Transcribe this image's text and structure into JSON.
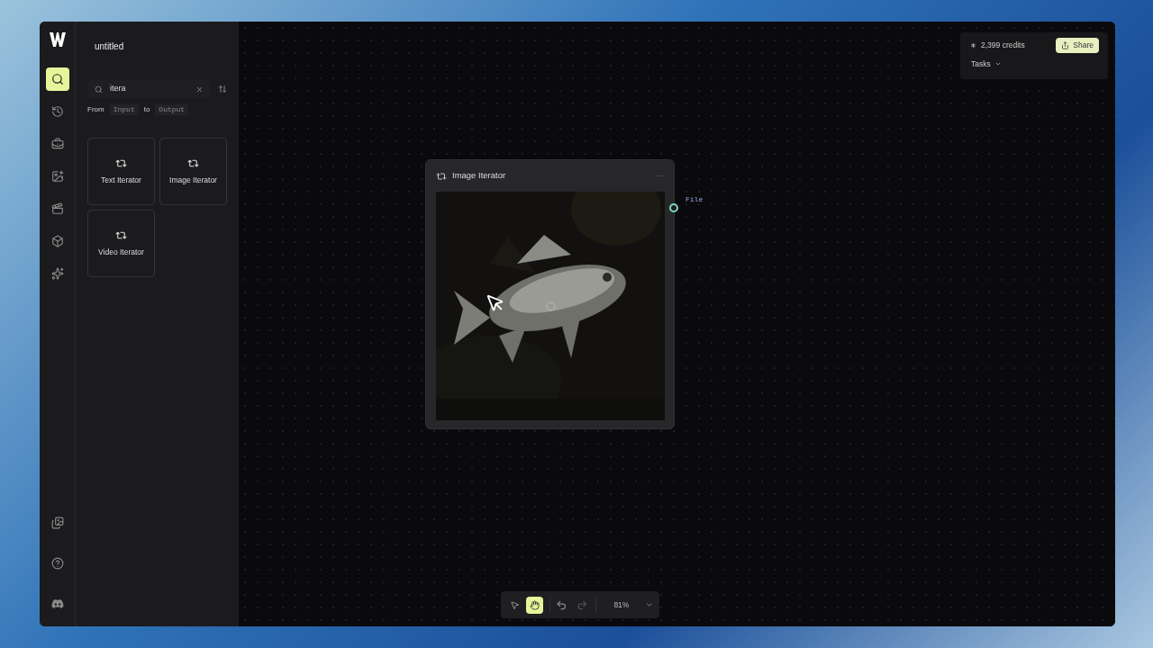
{
  "app": {
    "title": "untitled"
  },
  "rail": [
    {
      "selected": true
    },
    {
      "selected": false
    },
    {
      "selected": false
    },
    {
      "selected": false
    },
    {
      "selected": false
    },
    {
      "selected": false
    },
    {
      "selected": false
    }
  ],
  "rail_bottom": [
    {
      "selected": false
    },
    {
      "selected": false
    },
    {
      "selected": false
    }
  ],
  "search": {
    "value": "itera",
    "from_label": "From",
    "from": "Input",
    "to_label": "to",
    "to": "Output"
  },
  "results": [
    {
      "label": "Text Iterator"
    },
    {
      "label": "Image Iterator"
    },
    {
      "label": "Video Iterator"
    }
  ],
  "top_panel": {
    "credits": "2,399 credits",
    "share": "Share",
    "tasks": "Tasks"
  },
  "node": {
    "title": "Image Iterator",
    "menu": "···",
    "port": "File",
    "kind": "picture"
  },
  "toolbar": {
    "tools": [
      {
        "selected": false
      },
      {
        "selected": true
      }
    ],
    "zoom": "81%"
  }
}
